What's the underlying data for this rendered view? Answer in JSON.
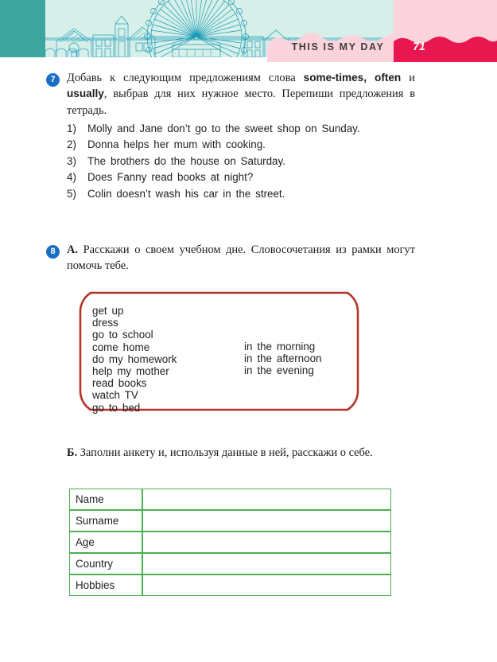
{
  "header": {
    "banner_title": "THIS IS MY DAY",
    "page_number": "71",
    "artwork_name": "london-eye-skyline-illustration",
    "colors": {
      "teal_block": "#3da69e",
      "mint_background": "#d6efe9",
      "artwork_line": "#1a9bb5",
      "pink_panel": "#fbd3dd",
      "crimson_band": "#e8174f"
    }
  },
  "exercise7": {
    "number": "7",
    "prompt_part1": "Добавь к следующим предложениям слова ",
    "prompt_bold1": "some-times,",
    "prompt_bold1_a": "some-",
    "prompt_bold1_b": "times,",
    "prompt_bold2": "often",
    "prompt_mid": " и ",
    "prompt_bold3": "usually",
    "prompt_part2": ", выбрав для них нужное место. Перепиши предложения в тетрадь.",
    "sentences": [
      {
        "num": "1)",
        "text": "Molly and Jane don’t go to the sweet shop on Sunday."
      },
      {
        "num": "2)",
        "text": "Donna helps her mum with cooking."
      },
      {
        "num": "3)",
        "text": "The brothers do the house on Saturday."
      },
      {
        "num": "4)",
        "text": "Does Fanny read books at night?"
      },
      {
        "num": "5)",
        "text": "Colin doesn’t wash his car in the street."
      }
    ]
  },
  "exercise8": {
    "number": "8",
    "partA_label": "А.",
    "partA_text": " Расскажи о своем учебном дне. Словосочетания из рамки могут помочь тебе.",
    "phrase_box": {
      "border_color": "#b5342a",
      "left_column": [
        "get up",
        "dress",
        "go to school",
        "come home",
        "do my homework",
        "help my mother",
        "read books",
        "watch TV",
        "go to bed"
      ],
      "right_column": [
        "in the morning",
        "in the afternoon",
        "in the evening"
      ]
    },
    "partB_label": "Б.",
    "partB_text": " Заполни анкету и, используя данные в ней, расскажи о себе.",
    "form": {
      "border_color": "#4caf50",
      "rows": [
        {
          "label": "Name",
          "value": ""
        },
        {
          "label": "Surname",
          "value": ""
        },
        {
          "label": "Age",
          "value": ""
        },
        {
          "label": "Country",
          "value": ""
        },
        {
          "label": "Hobbies",
          "value": ""
        }
      ]
    }
  }
}
